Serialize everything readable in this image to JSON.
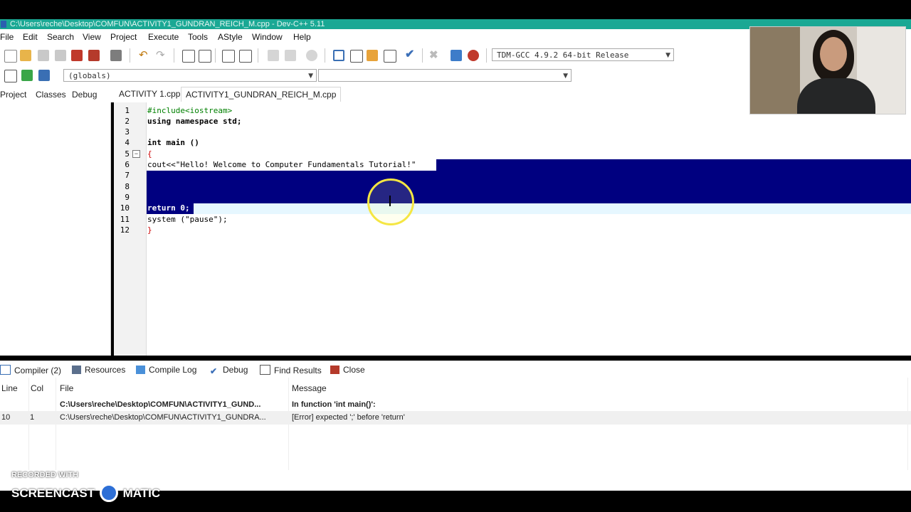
{
  "window": {
    "title": "C:\\Users\\reche\\Desktop\\COMFUN\\ACTIVITY1_GUNDRAN_REICH_M.cpp - Dev-C++ 5.11"
  },
  "menu": [
    "File",
    "Edit",
    "Search",
    "View",
    "Project",
    "Execute",
    "Tools",
    "AStyle",
    "Window",
    "Help"
  ],
  "toolbar": {
    "compiler_select": "TDM-GCC 4.9.2 64-bit Release",
    "globals_select": "(globals)",
    "function_select": ""
  },
  "left_tabs": [
    "Project",
    "Classes",
    "Debug"
  ],
  "editor_tabs": [
    "ACTIVITY 1.cpp",
    "ACTIVITY1_GUNDRAN_REICH_M.cpp"
  ],
  "code_lines": [
    {
      "n": "1",
      "text": "#include<iostream>"
    },
    {
      "n": "2",
      "text": "using namespace std;"
    },
    {
      "n": "3",
      "text": ""
    },
    {
      "n": "4",
      "text": "int main ()"
    },
    {
      "n": "5",
      "text": "{"
    },
    {
      "n": "6",
      "text": "cout<<\"Hello! Welcome to Computer Fundamentals Tutorial!\""
    },
    {
      "n": "7",
      "text": ""
    },
    {
      "n": "8",
      "text": ""
    },
    {
      "n": "9",
      "text": ""
    },
    {
      "n": "10",
      "text": "return 0;"
    },
    {
      "n": "11",
      "text": "system (\"pause\");"
    },
    {
      "n": "12",
      "text": "}"
    }
  ],
  "bottom_tabs": [
    "Compiler (2)",
    "Resources",
    "Compile Log",
    "Debug",
    "Find Results",
    "Close"
  ],
  "messages": {
    "headers": [
      "Line",
      "Col",
      "File",
      "Message"
    ],
    "rows": [
      {
        "line": "",
        "col": "",
        "file": "C:\\Users\\reche\\Desktop\\COMFUN\\ACTIVITY1_GUND...",
        "message": "In function 'int main()':"
      },
      {
        "line": "10",
        "col": "1",
        "file": "C:\\Users\\reche\\Desktop\\COMFUN\\ACTIVITY1_GUNDRA...",
        "message": "[Error] expected ';' before 'return'"
      }
    ]
  },
  "watermark": {
    "line1": "RECORDED WITH",
    "line2": "SCREENCAST",
    "line3": "MATIC"
  }
}
